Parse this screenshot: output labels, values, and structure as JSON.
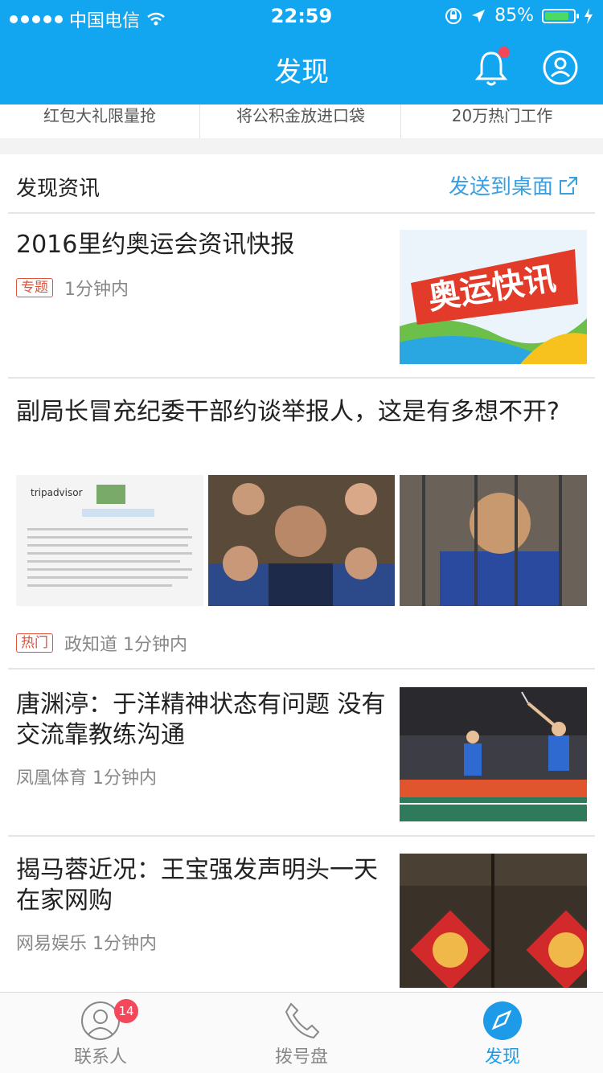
{
  "status_bar": {
    "carrier": "中国电信",
    "time": "22:59",
    "battery_text": "85%",
    "battery_level": 0.85,
    "icons": [
      "signal-dots-icon",
      "wifi-icon",
      "orientation-lock-icon",
      "location-arrow-icon",
      "battery-icon",
      "charging-icon"
    ]
  },
  "nav": {
    "title": "发现",
    "icons": [
      "bell-icon",
      "user-icon"
    ]
  },
  "shortcuts": [
    {
      "label": "红包大礼限量抢"
    },
    {
      "label": "将公积金放进口袋"
    },
    {
      "label": "20万热门工作"
    }
  ],
  "section": {
    "title": "发现资讯",
    "send_label": "发送到桌面"
  },
  "feed": {
    "item1": {
      "title": "2016里约奥运会资讯快报",
      "tag": "专题",
      "time": "1分钟内",
      "thumb_text": "奥运快讯"
    },
    "item2": {
      "title": "副局长冒充纪委干部约谈举报人，这是有多想不开?",
      "tag": "热门",
      "source_time": "政知道 1分钟内",
      "img1_brand": "tripadvisor"
    },
    "item3": {
      "title": "唐渊渟：于洋精神状态有问题 没有交流靠教练沟通",
      "source_time": "凤凰体育 1分钟内"
    },
    "item4": {
      "title": "揭马蓉近况：王宝强发声明头一天在家网购",
      "source_time": "网易娱乐 1分钟内"
    }
  },
  "tabbar": {
    "contacts": {
      "label": "联系人",
      "badge": "14"
    },
    "dialpad": {
      "label": "拨号盘"
    },
    "discover": {
      "label": "发现"
    }
  },
  "colors": {
    "brand_blue": "#12a6f0",
    "link_blue": "#3a9fe0",
    "tag_red": "#e0533b",
    "badge_red": "#f4475a"
  }
}
